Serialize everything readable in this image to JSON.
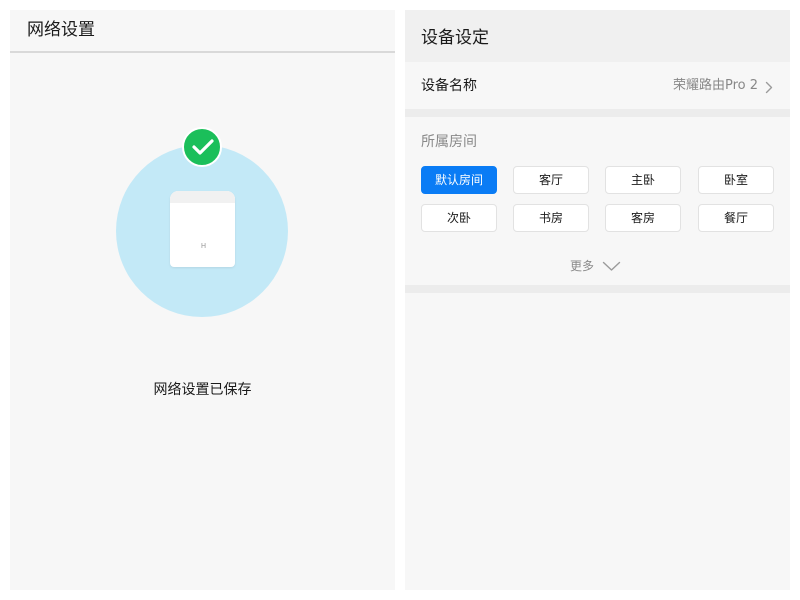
{
  "left_screen": {
    "title": "网络设置",
    "status_message": "网络设置已保存",
    "icons": {
      "success": "checkmark-circle-icon",
      "device": "router-device-icon"
    },
    "colors": {
      "circle_background": "#c3e9f7",
      "success_green": "#1bbf5a"
    }
  },
  "right_screen": {
    "title": "设备设定",
    "device_name": {
      "label": "设备名称",
      "value": "荣耀路由Pro 2"
    },
    "room": {
      "title": "所属房间",
      "selected": "默认房间",
      "options": [
        "默认房间",
        "客厅",
        "主卧",
        "卧室",
        "次卧",
        "书房",
        "客房",
        "餐厅"
      ],
      "more_label": "更多"
    },
    "colors": {
      "accent": "#0a7cf5"
    }
  }
}
